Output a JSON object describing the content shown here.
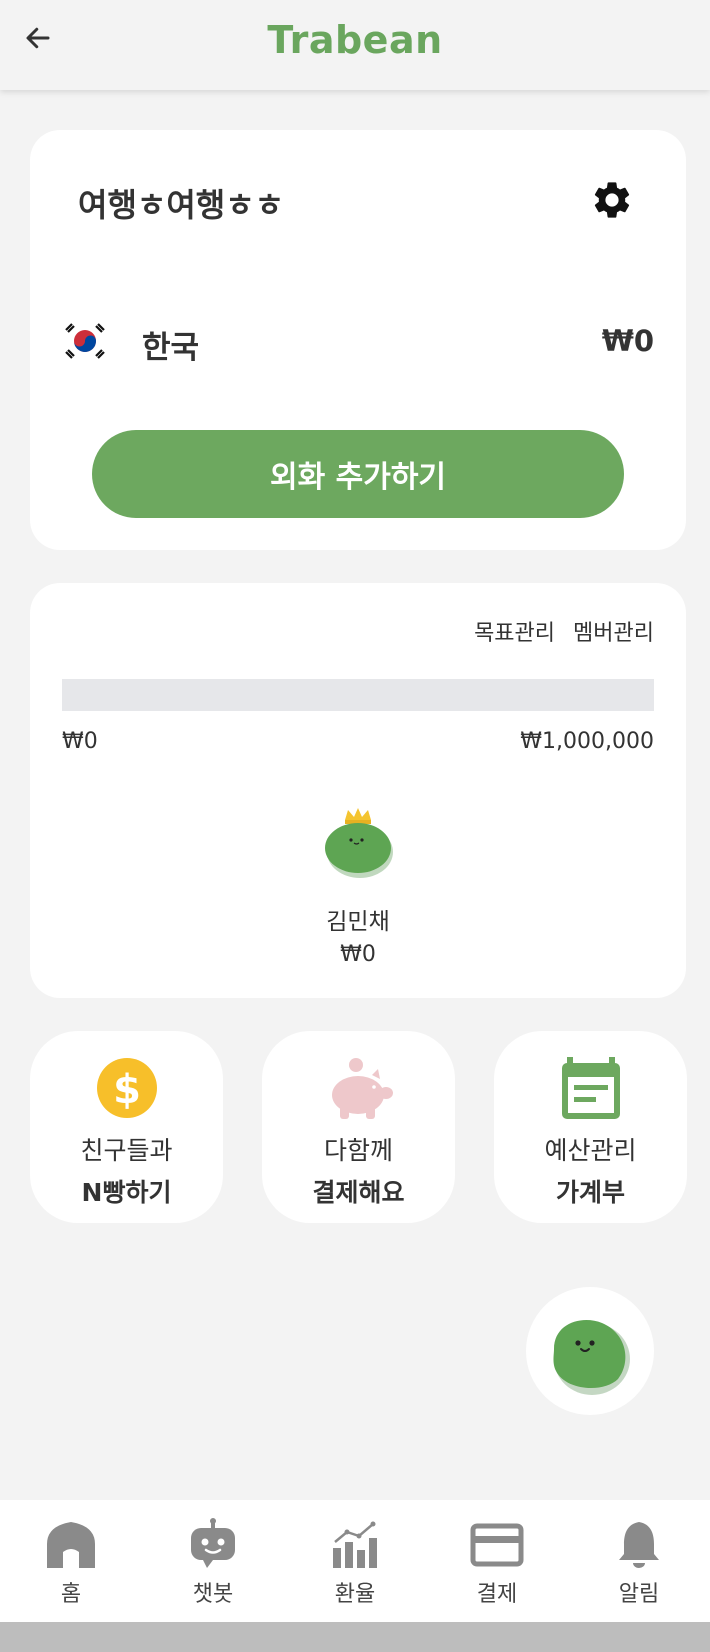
{
  "header": {
    "logo": "Trabean"
  },
  "trip": {
    "title": "여행ㅎ여행ㅎㅎ",
    "country": "한국",
    "balance": "₩0",
    "add_currency_label": "외화 추가하기"
  },
  "goal": {
    "goal_manage_label": "목표관리",
    "member_manage_label": "멤버관리",
    "progress": 0,
    "min_label": "₩0",
    "max_label": "₩1,000,000",
    "member": {
      "name": "김민채",
      "amount": "₩0"
    }
  },
  "features": [
    {
      "icon": "dollar-coin-icon",
      "line1": "친구들과",
      "line2": "N빵하기"
    },
    {
      "icon": "piggy-bank-icon",
      "line1": "다함께",
      "line2": "결제해요"
    },
    {
      "icon": "calendar-icon",
      "line1": "예산관리",
      "line2": "가계부"
    }
  ],
  "nav": [
    {
      "icon": "home-icon",
      "label": "홈"
    },
    {
      "icon": "robot-icon",
      "label": "챗봇"
    },
    {
      "icon": "chart-icon",
      "label": "환율"
    },
    {
      "icon": "card-icon",
      "label": "결제"
    },
    {
      "icon": "bell-icon",
      "label": "알림"
    }
  ],
  "colors": {
    "accent": "#6da85f",
    "logo": "#6aa65e",
    "coin": "#f7bf2a",
    "piggy": "#eec8cb"
  }
}
